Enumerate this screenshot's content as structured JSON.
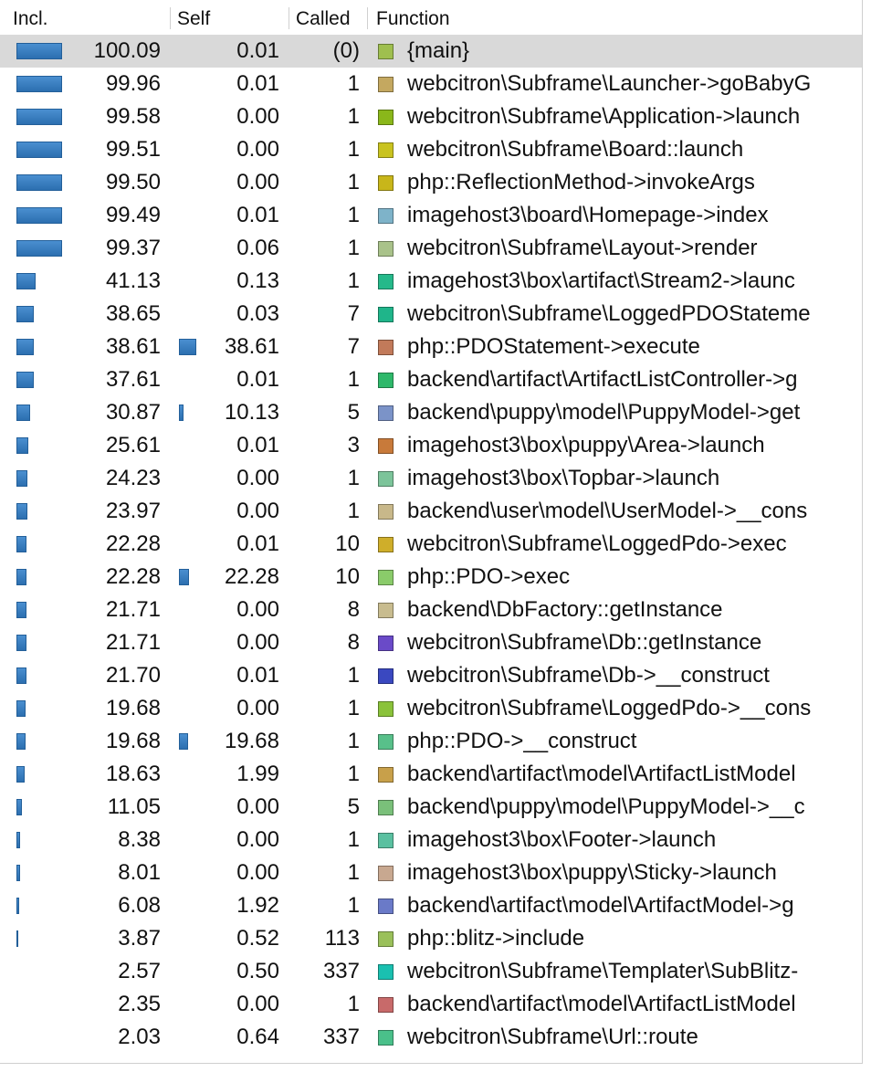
{
  "columns": {
    "incl": "Incl.",
    "self": "Self",
    "called": "Called",
    "function": "Function"
  },
  "rows": [
    {
      "incl": "100.09",
      "self": "0.01",
      "called": "(0)",
      "function": "{main}",
      "color": "#9fbf4f",
      "incl_pct": 100.09,
      "self_pct": 0.01,
      "selected": true
    },
    {
      "incl": "99.96",
      "self": "0.01",
      "called": "1",
      "function": "webcitron\\Subframe\\Launcher->goBabyG",
      "color": "#c4a860",
      "incl_pct": 99.96,
      "self_pct": 0.01
    },
    {
      "incl": "99.58",
      "self": "0.00",
      "called": "1",
      "function": "webcitron\\Subframe\\Application->launch",
      "color": "#8ab71a",
      "incl_pct": 99.58,
      "self_pct": 0.0
    },
    {
      "incl": "99.51",
      "self": "0.00",
      "called": "1",
      "function": "webcitron\\Subframe\\Board::launch",
      "color": "#c9c31f",
      "incl_pct": 99.51,
      "self_pct": 0.0
    },
    {
      "incl": "99.50",
      "self": "0.00",
      "called": "1",
      "function": "php::ReflectionMethod->invokeArgs",
      "color": "#c8b61a",
      "incl_pct": 99.5,
      "self_pct": 0.0
    },
    {
      "incl": "99.49",
      "self": "0.01",
      "called": "1",
      "function": "imagehost3\\board\\Homepage->index",
      "color": "#7eb3c9",
      "incl_pct": 99.49,
      "self_pct": 0.01
    },
    {
      "incl": "99.37",
      "self": "0.06",
      "called": "1",
      "function": "webcitron\\Subframe\\Layout->render",
      "color": "#a9c28a",
      "incl_pct": 99.37,
      "self_pct": 0.06
    },
    {
      "incl": "41.13",
      "self": "0.13",
      "called": "1",
      "function": "imagehost3\\box\\artifact\\Stream2->launc",
      "color": "#25b98a",
      "incl_pct": 41.13,
      "self_pct": 0.13
    },
    {
      "incl": "38.65",
      "self": "0.03",
      "called": "7",
      "function": "webcitron\\Subframe\\LoggedPDOStateme",
      "color": "#1fb58a",
      "incl_pct": 38.65,
      "self_pct": 0.03
    },
    {
      "incl": "38.61",
      "self": "38.61",
      "called": "7",
      "function": "php::PDOStatement->execute",
      "color": "#c27a5a",
      "incl_pct": 38.61,
      "self_pct": 38.61
    },
    {
      "incl": "37.61",
      "self": "0.01",
      "called": "1",
      "function": "backend\\artifact\\ArtifactListController->g",
      "color": "#2eb86a",
      "incl_pct": 37.61,
      "self_pct": 0.01
    },
    {
      "incl": "30.87",
      "self": "10.13",
      "called": "5",
      "function": "backend\\puppy\\model\\PuppyModel->get",
      "color": "#7b93c8",
      "incl_pct": 30.87,
      "self_pct": 10.13
    },
    {
      "incl": "25.61",
      "self": "0.01",
      "called": "3",
      "function": "imagehost3\\box\\puppy\\Area->launch",
      "color": "#c87a3a",
      "incl_pct": 25.61,
      "self_pct": 0.01
    },
    {
      "incl": "24.23",
      "self": "0.00",
      "called": "1",
      "function": "imagehost3\\box\\Topbar->launch",
      "color": "#7cc49a",
      "incl_pct": 24.23,
      "self_pct": 0.0
    },
    {
      "incl": "23.97",
      "self": "0.00",
      "called": "1",
      "function": "backend\\user\\model\\UserModel->__cons",
      "color": "#c8b88a",
      "incl_pct": 23.97,
      "self_pct": 0.0
    },
    {
      "incl": "22.28",
      "self": "0.01",
      "called": "10",
      "function": "webcitron\\Subframe\\LoggedPdo->exec",
      "color": "#cfae2a",
      "incl_pct": 22.28,
      "self_pct": 0.01
    },
    {
      "incl": "22.28",
      "self": "22.28",
      "called": "10",
      "function": "php::PDO->exec",
      "color": "#8acb6a",
      "incl_pct": 22.28,
      "self_pct": 22.28
    },
    {
      "incl": "21.71",
      "self": "0.00",
      "called": "8",
      "function": "backend\\DbFactory::getInstance",
      "color": "#c8bc8f",
      "incl_pct": 21.71,
      "self_pct": 0.0
    },
    {
      "incl": "21.71",
      "self": "0.00",
      "called": "8",
      "function": "webcitron\\Subframe\\Db::getInstance",
      "color": "#6a4ac8",
      "incl_pct": 21.71,
      "self_pct": 0.0
    },
    {
      "incl": "21.70",
      "self": "0.01",
      "called": "1",
      "function": "webcitron\\Subframe\\Db->__construct",
      "color": "#3a48c0",
      "incl_pct": 21.7,
      "self_pct": 0.01
    },
    {
      "incl": "19.68",
      "self": "0.00",
      "called": "1",
      "function": "webcitron\\Subframe\\LoggedPdo->__cons",
      "color": "#8ac23a",
      "incl_pct": 19.68,
      "self_pct": 0.0
    },
    {
      "incl": "19.68",
      "self": "19.68",
      "called": "1",
      "function": "php::PDO->__construct",
      "color": "#58c08a",
      "incl_pct": 19.68,
      "self_pct": 19.68
    },
    {
      "incl": "18.63",
      "self": "1.99",
      "called": "1",
      "function": "backend\\artifact\\model\\ArtifactListModel",
      "color": "#c8a04a",
      "incl_pct": 18.63,
      "self_pct": 1.99
    },
    {
      "incl": "11.05",
      "self": "0.00",
      "called": "5",
      "function": "backend\\puppy\\model\\PuppyModel->__c",
      "color": "#7ac07a",
      "incl_pct": 11.05,
      "self_pct": 0.0
    },
    {
      "incl": "8.38",
      "self": "0.00",
      "called": "1",
      "function": "imagehost3\\box\\Footer->launch",
      "color": "#5ac0a0",
      "incl_pct": 8.38,
      "self_pct": 0.0
    },
    {
      "incl": "8.01",
      "self": "0.00",
      "called": "1",
      "function": "imagehost3\\box\\puppy\\Sticky->launch",
      "color": "#c8a890",
      "incl_pct": 8.01,
      "self_pct": 0.0
    },
    {
      "incl": "6.08",
      "self": "1.92",
      "called": "1",
      "function": "backend\\artifact\\model\\ArtifactModel->g",
      "color": "#6a7ac8",
      "incl_pct": 6.08,
      "self_pct": 1.92
    },
    {
      "incl": "3.87",
      "self": "0.52",
      "called": "113",
      "function": "php::blitz->include",
      "color": "#9ac05a",
      "incl_pct": 3.87,
      "self_pct": 0.52
    },
    {
      "incl": "2.57",
      "self": "0.50",
      "called": "337",
      "function": "webcitron\\Subframe\\Templater\\SubBlitz-",
      "color": "#1ac0b0",
      "incl_pct": 2.57,
      "self_pct": 0.5
    },
    {
      "incl": "2.35",
      "self": "0.00",
      "called": "1",
      "function": "backend\\artifact\\model\\ArtifactListModel",
      "color": "#c86a6a",
      "incl_pct": 2.35,
      "self_pct": 0.0
    },
    {
      "incl": "2.03",
      "self": "0.64",
      "called": "337",
      "function": "webcitron\\Subframe\\Url::route",
      "color": "#4ac08a",
      "incl_pct": 2.03,
      "self_pct": 0.64
    }
  ]
}
